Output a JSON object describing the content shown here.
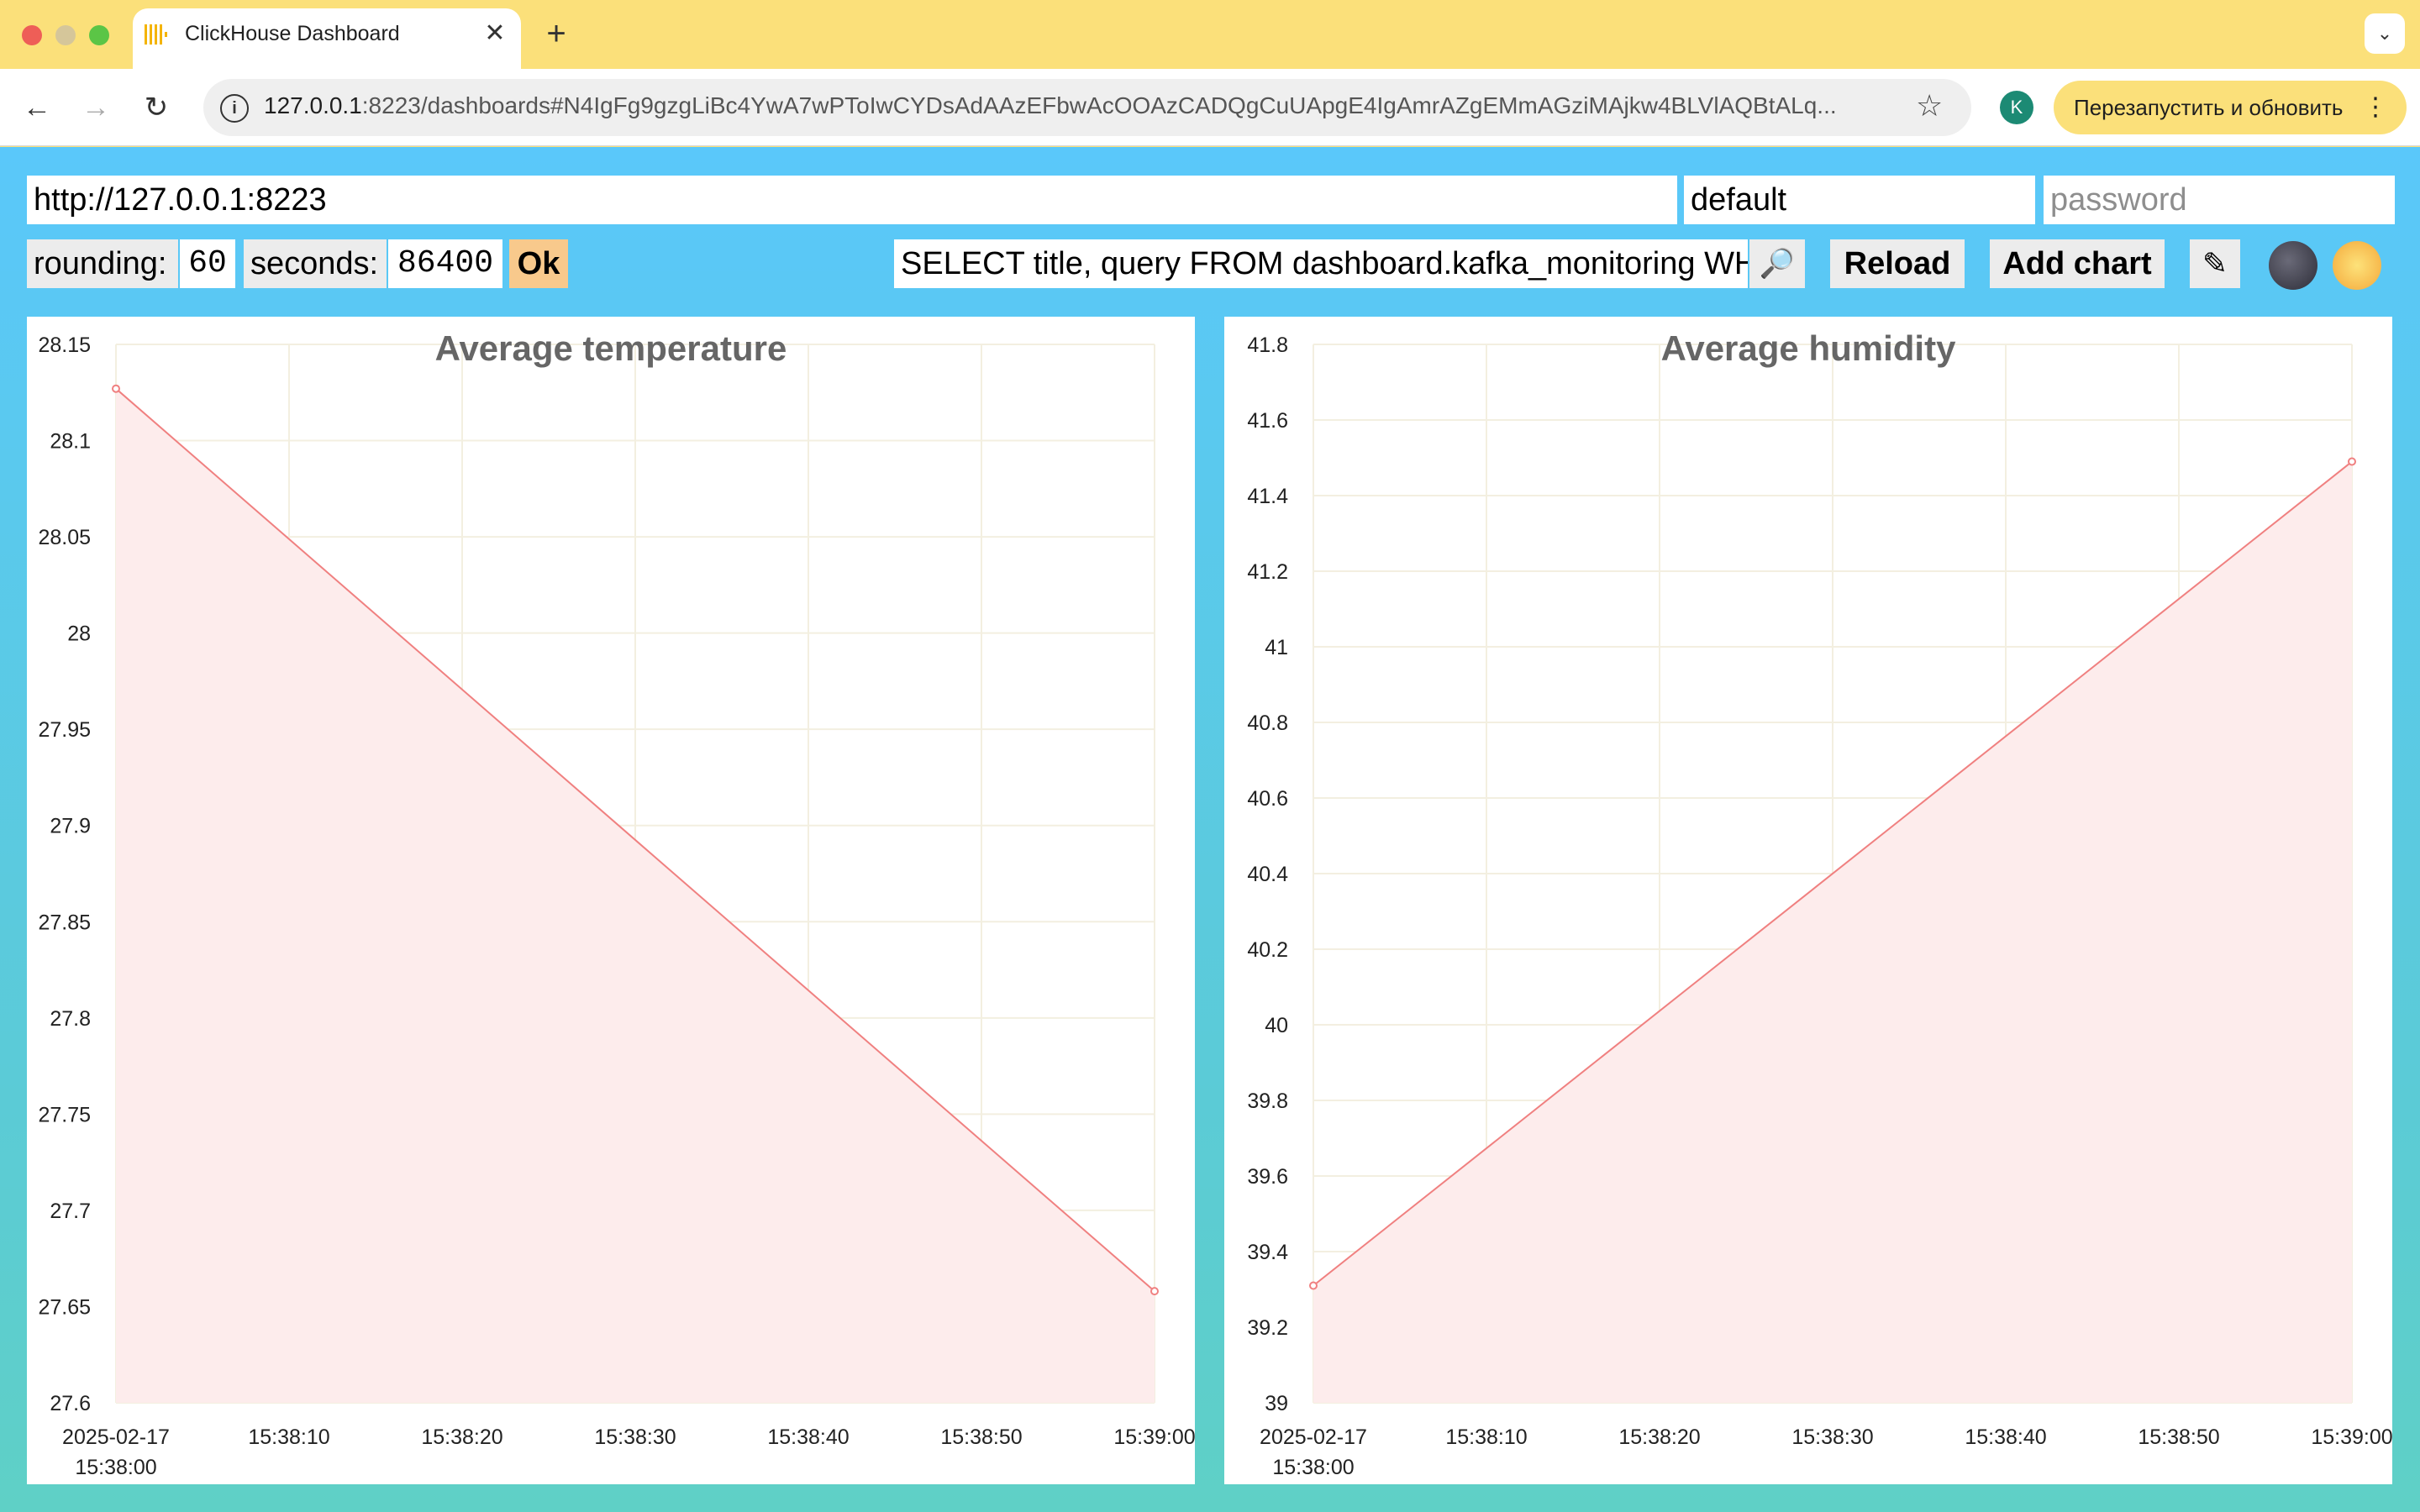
{
  "browser": {
    "tab_title": "ClickHouse Dashboard",
    "tab_close": "✕",
    "new_tab": "+",
    "tab_menu": "⌄",
    "url_host": "127.0.0.1",
    "url_rest": ":8223/dashboards#N4IgFg9gzgLiBc4YwA7wPToIwCYDsAdAAzEFbwAcOOAzCADQgCuUApgE4IgAmrAZgEMmAGziMAjkw4BLVlAQBtALq...",
    "update_button": "Перезапустить и обновить",
    "avatar_letter": "K"
  },
  "controls": {
    "url_value": "http://127.0.0.1:8223",
    "user_value": "default",
    "password_placeholder": "password",
    "rounding_label": "rounding:",
    "rounding_value": "60",
    "seconds_label": "seconds:",
    "seconds_value": "86400",
    "ok_label": "Ok",
    "query_value": "SELECT title, query FROM dashboard.kafka_monitoring WH",
    "reload_label": "Reload",
    "add_chart_label": "Add chart",
    "edit_icon": "✎",
    "moon_icon": "🌑",
    "sun_icon": "🌞"
  },
  "colors": {
    "line": "#f08080",
    "fill": "#fdecec",
    "grid": "#f3efe0"
  },
  "chart_data": [
    {
      "type": "area",
      "title": "Average temperature",
      "x": [
        "2025-02-17 15:38:00",
        "2025-02-17 15:39:00"
      ],
      "values": [
        28.127,
        27.658
      ],
      "ylim": [
        27.6,
        28.15
      ],
      "yticks": [
        "28.15",
        "28.1",
        "28.05",
        "28",
        "27.95",
        "27.9",
        "27.85",
        "27.8",
        "27.75",
        "27.7",
        "27.65",
        "27.6"
      ],
      "xticks": [
        "2025-02-17",
        "15:38:10",
        "15:38:20",
        "15:38:30",
        "15:38:40",
        "15:38:50",
        "15:39:00"
      ],
      "xtick_sub": "15:38:00",
      "grid": true
    },
    {
      "type": "area",
      "title": "Average humidity",
      "x": [
        "2025-02-17 15:38:00",
        "2025-02-17 15:39:00"
      ],
      "values": [
        39.31,
        41.49
      ],
      "ylim": [
        39,
        41.8
      ],
      "yticks": [
        "41.8",
        "41.6",
        "41.4",
        "41.2",
        "41",
        "40.8",
        "40.6",
        "40.4",
        "40.2",
        "40",
        "39.8",
        "39.6",
        "39.4",
        "39.2",
        "39"
      ],
      "xticks": [
        "2025-02-17",
        "15:38:10",
        "15:38:20",
        "15:38:30",
        "15:38:40",
        "15:38:50",
        "15:39:00"
      ],
      "xtick_sub": "15:38:00",
      "grid": true
    }
  ]
}
